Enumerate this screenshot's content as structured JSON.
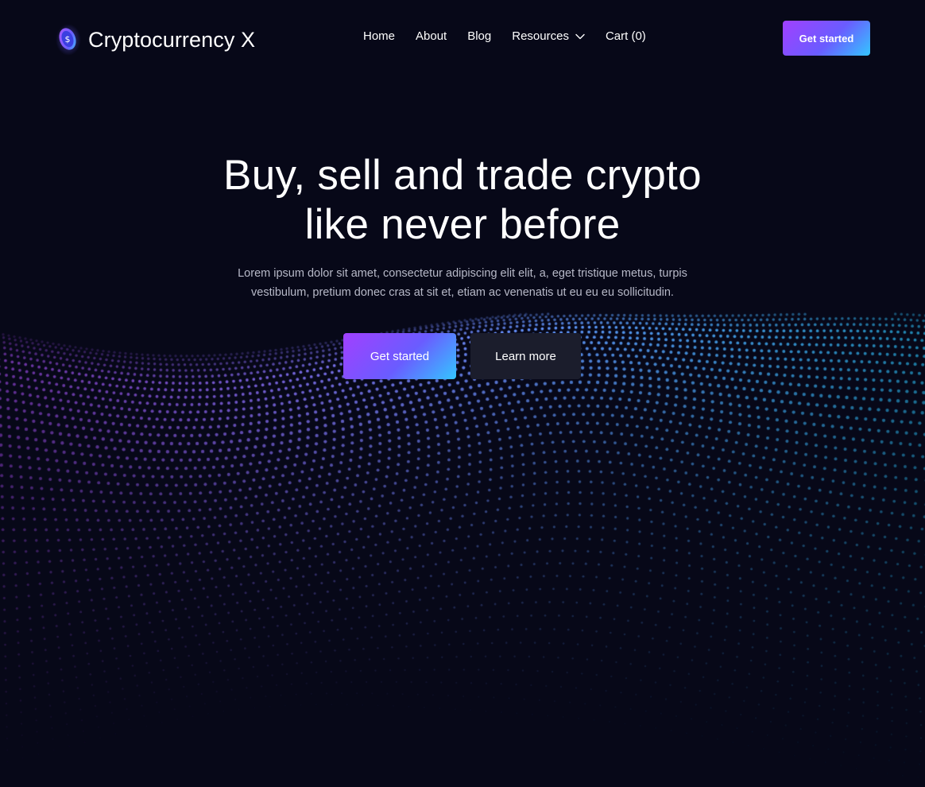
{
  "brand": {
    "name": "Cryptocurrency X",
    "logo_icon": "coin-icon",
    "logo_symbol": "$"
  },
  "nav": {
    "items": [
      {
        "label": "Home"
      },
      {
        "label": "About"
      },
      {
        "label": "Blog"
      },
      {
        "label": "Resources",
        "icon": "chevron-down-icon"
      },
      {
        "label": "Cart (0)"
      }
    ]
  },
  "header": {
    "cta_label": "Get started"
  },
  "hero": {
    "title_line1": "Buy, sell and trade crypto",
    "title_line2": "like never before",
    "description_line1": "Lorem ipsum dolor sit amet, consectetur adipiscing elit elit, a, eget tristique metus, turpis",
    "description_line2": "vestibulum, pretium donec cras at sit et, etiam ac venenatis ut eu eu eu sollicitudin.",
    "primary_button": "Get started",
    "secondary_button": "Learn more"
  },
  "colors": {
    "background": "#070818",
    "accent_purple": "#a140ff",
    "accent_blue": "#34c6ff",
    "secondary_button_bg": "#1b1d2c",
    "body_text": "#b7b9c8"
  }
}
